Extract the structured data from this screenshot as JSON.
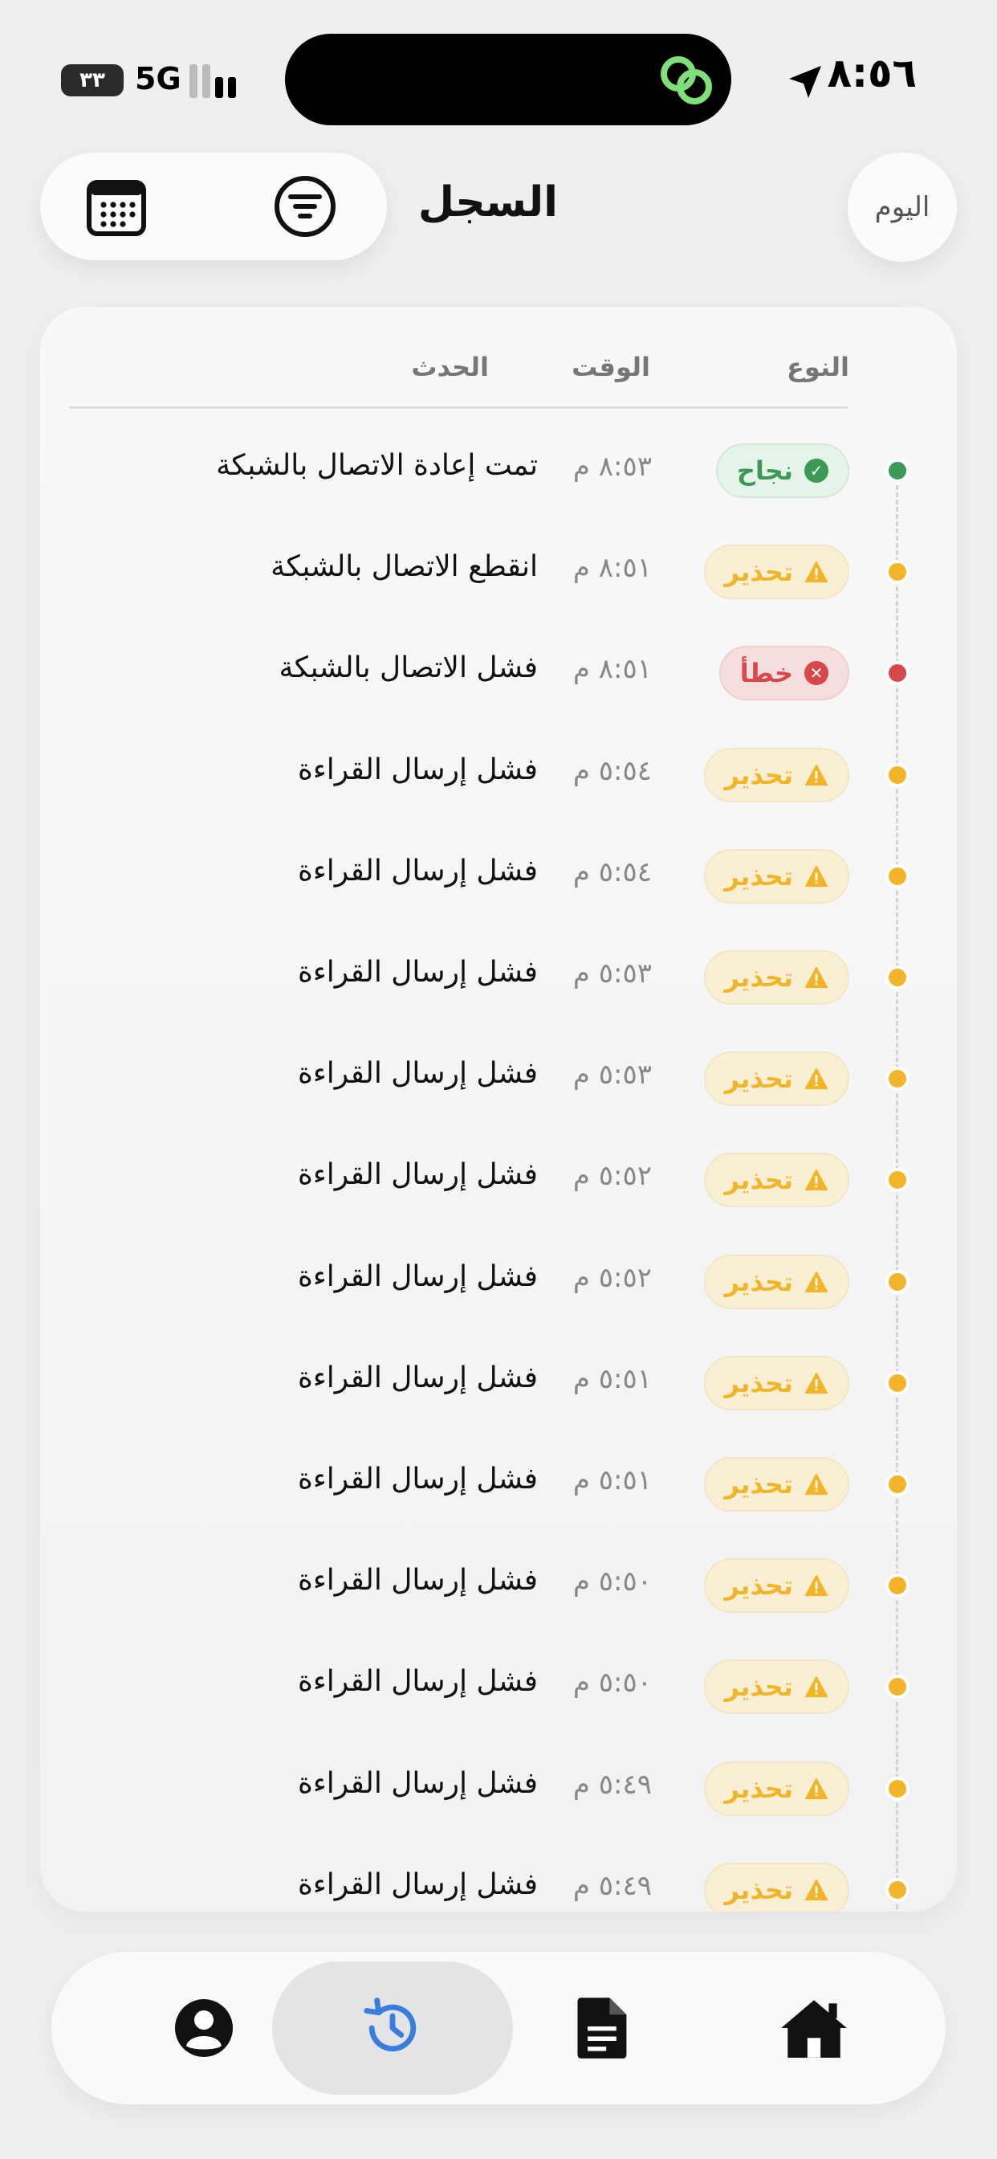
{
  "status_bar": {
    "time": "٨:٥٦",
    "network": "5G",
    "battery": "٣٣"
  },
  "header": {
    "title": "السجل",
    "today_label": "اليوم"
  },
  "log": {
    "columns": {
      "type": "النوع",
      "time": "الوقت",
      "event": "الحدث"
    },
    "rows": [
      {
        "kind": "success",
        "badge": "نجاح",
        "time": "٨:٥٣ م",
        "event": "تمت إعادة الاتصال بالشبكة"
      },
      {
        "kind": "warning",
        "badge": "تحذير",
        "time": "٨:٥١ م",
        "event": "انقطع الاتصال بالشبكة"
      },
      {
        "kind": "error",
        "badge": "خطأ",
        "time": "٨:٥١ م",
        "event": "فشل الاتصال بالشبكة"
      },
      {
        "kind": "warning",
        "badge": "تحذير",
        "time": "٥:٥٤ م",
        "event": "فشل إرسال القراءة"
      },
      {
        "kind": "warning",
        "badge": "تحذير",
        "time": "٥:٥٤ م",
        "event": "فشل إرسال القراءة"
      },
      {
        "kind": "warning",
        "badge": "تحذير",
        "time": "٥:٥٣ م",
        "event": "فشل إرسال القراءة"
      },
      {
        "kind": "warning",
        "badge": "تحذير",
        "time": "٥:٥٣ م",
        "event": "فشل إرسال القراءة"
      },
      {
        "kind": "warning",
        "badge": "تحذير",
        "time": "٥:٥٢ م",
        "event": "فشل إرسال القراءة"
      },
      {
        "kind": "warning",
        "badge": "تحذير",
        "time": "٥:٥٢ م",
        "event": "فشل إرسال القراءة"
      },
      {
        "kind": "warning",
        "badge": "تحذير",
        "time": "٥:٥١ م",
        "event": "فشل إرسال القراءة"
      },
      {
        "kind": "warning",
        "badge": "تحذير",
        "time": "٥:٥١ م",
        "event": "فشل إرسال القراءة"
      },
      {
        "kind": "warning",
        "badge": "تحذير",
        "time": "٥:٥٠ م",
        "event": "فشل إرسال القراءة"
      },
      {
        "kind": "warning",
        "badge": "تحذير",
        "time": "٥:٥٠ م",
        "event": "فشل إرسال القراءة"
      },
      {
        "kind": "warning",
        "badge": "تحذير",
        "time": "٥:٤٩ م",
        "event": "فشل إرسال القراءة"
      },
      {
        "kind": "warning",
        "badge": "تحذير",
        "time": "٥:٤٩ م",
        "event": "فشل إرسال القراءة"
      }
    ]
  },
  "colors": {
    "success": "#3c9a57",
    "warning": "#f2b52a",
    "error": "#d94848",
    "active_tab_icon": "#3b7ddd",
    "island_icon": "#7fe07a"
  },
  "tab_bar": {
    "active": "history",
    "tabs": [
      {
        "id": "profile",
        "icon": "person-circle-icon"
      },
      {
        "id": "history",
        "icon": "history-clock-icon"
      },
      {
        "id": "report",
        "icon": "document-icon"
      },
      {
        "id": "home",
        "icon": "home-icon"
      }
    ]
  }
}
